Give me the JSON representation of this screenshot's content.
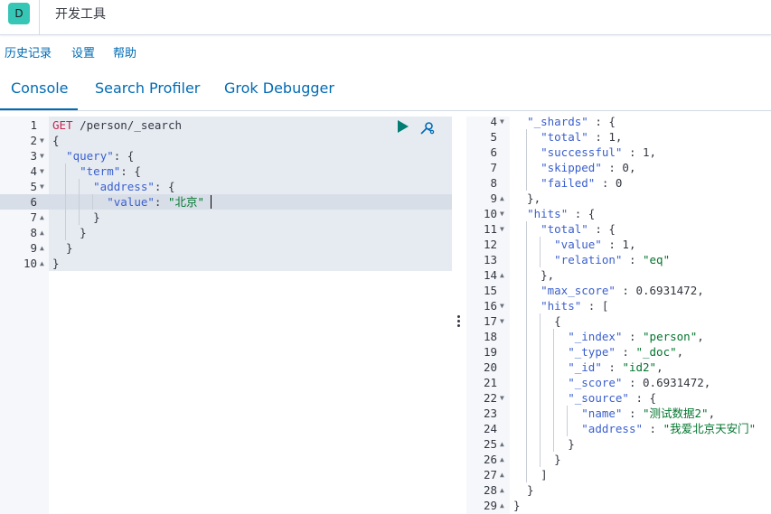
{
  "header": {
    "avatar_letter": "D",
    "title": "开发工具"
  },
  "topmenu": {
    "history": "历史记录",
    "settings": "设置",
    "help": "帮助"
  },
  "tabs": [
    {
      "label": "Console",
      "selected": true
    },
    {
      "label": "Search Profiler",
      "selected": false
    },
    {
      "label": "Grok Debugger",
      "selected": false
    }
  ],
  "request": {
    "method": "GET",
    "path": "/person/_search",
    "lines": [
      {
        "n": "1",
        "text": ""
      },
      {
        "n": "2",
        "text": "{"
      },
      {
        "n": "3",
        "text": "  \"query\": {"
      },
      {
        "n": "4",
        "text": "    \"term\": {"
      },
      {
        "n": "5",
        "text": "      \"address\": {"
      },
      {
        "n": "6",
        "text": "        \"value\": \"北京\""
      },
      {
        "n": "7",
        "text": "      }"
      },
      {
        "n": "8",
        "text": "    }"
      },
      {
        "n": "9",
        "text": "  }"
      },
      {
        "n": "10",
        "text": "}"
      }
    ]
  },
  "response": {
    "lines": [
      {
        "n": "4",
        "text": "  \"_shards\" : {"
      },
      {
        "n": "5",
        "text": "    \"total\" : 1,"
      },
      {
        "n": "6",
        "text": "    \"successful\" : 1,"
      },
      {
        "n": "7",
        "text": "    \"skipped\" : 0,"
      },
      {
        "n": "8",
        "text": "    \"failed\" : 0"
      },
      {
        "n": "9",
        "text": "  },"
      },
      {
        "n": "10",
        "text": "  \"hits\" : {"
      },
      {
        "n": "11",
        "text": "    \"total\" : {"
      },
      {
        "n": "12",
        "text": "      \"value\" : 1,"
      },
      {
        "n": "13",
        "text": "      \"relation\" : \"eq\""
      },
      {
        "n": "14",
        "text": "    },"
      },
      {
        "n": "15",
        "text": "    \"max_score\" : 0.6931472,"
      },
      {
        "n": "16",
        "text": "    \"hits\" : ["
      },
      {
        "n": "17",
        "text": "      {"
      },
      {
        "n": "18",
        "text": "        \"_index\" : \"person\","
      },
      {
        "n": "19",
        "text": "        \"_type\" : \"_doc\","
      },
      {
        "n": "20",
        "text": "        \"_id\" : \"id2\","
      },
      {
        "n": "21",
        "text": "        \"_score\" : 0.6931472,"
      },
      {
        "n": "22",
        "text": "        \"_source\" : {"
      },
      {
        "n": "23",
        "text": "          \"name\" : \"测试数据2\","
      },
      {
        "n": "24",
        "text": "          \"address\" : \"我爱北京天安门\""
      },
      {
        "n": "25",
        "text": "        }"
      },
      {
        "n": "26",
        "text": "      }"
      },
      {
        "n": "27",
        "text": "    ]"
      },
      {
        "n": "28",
        "text": "  }"
      },
      {
        "n": "29",
        "text": "}"
      }
    ]
  },
  "icons": {
    "play": "play-icon",
    "wrench": "wrench-icon",
    "resizer": "vertical-dots-icon"
  },
  "colors": {
    "accent": "#006bb4",
    "avatar": "#35c6b5",
    "string": "#00752d",
    "method": "#c7254e"
  }
}
